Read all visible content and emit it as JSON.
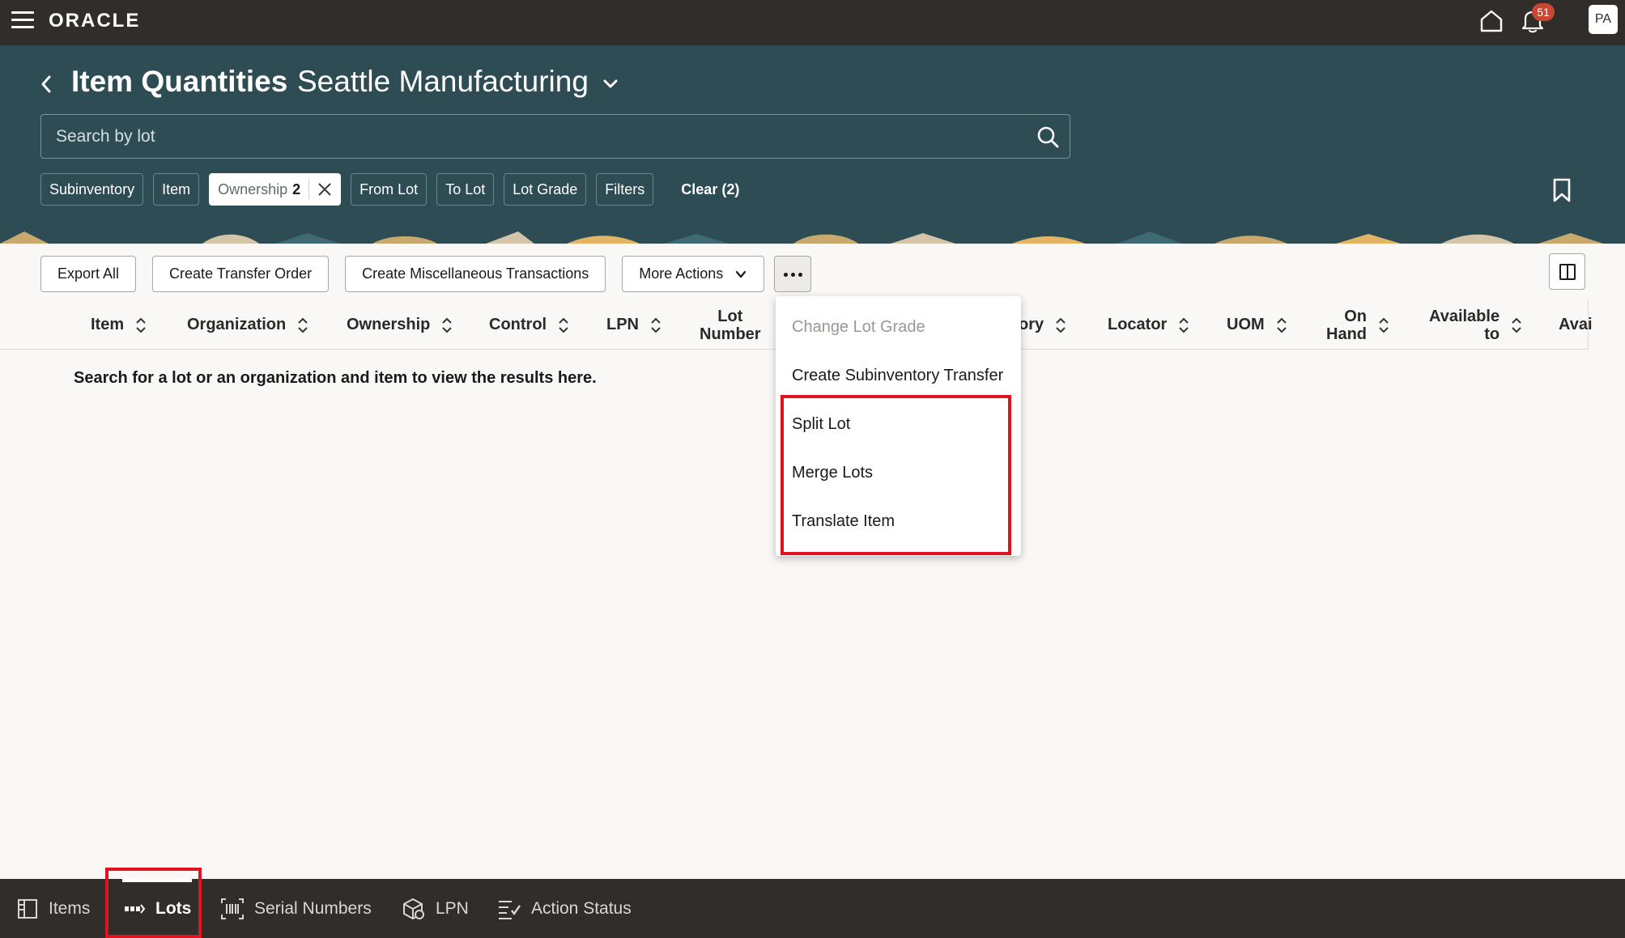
{
  "topbar": {
    "logo": "ORACLE",
    "notification_count": "51",
    "avatar_initials": "PA"
  },
  "header": {
    "title": "Item Quantities",
    "organization": "Seattle Manufacturing",
    "search": {
      "placeholder": "Search by lot",
      "value": ""
    },
    "chips": [
      {
        "label": "Subinventory"
      },
      {
        "label": "Item"
      },
      {
        "label": "Ownership",
        "count": "2"
      },
      {
        "label": "From Lot"
      },
      {
        "label": "To Lot"
      },
      {
        "label": "Lot Grade"
      },
      {
        "label": "Filters"
      }
    ],
    "clear_label": "Clear (2)"
  },
  "toolbar": {
    "export_all": "Export All",
    "create_transfer_order": "Create Transfer Order",
    "create_misc_transactions": "Create Miscellaneous Transactions",
    "more_actions": "More Actions"
  },
  "table": {
    "columns": [
      {
        "line1": "Item"
      },
      {
        "line1": "Organization"
      },
      {
        "line1": "Ownership"
      },
      {
        "line1": "Control"
      },
      {
        "line1": "LPN"
      },
      {
        "line1": "Lot",
        "line2": "Number"
      },
      {
        "line1": "ory"
      },
      {
        "line1": "Locator"
      },
      {
        "line1": "UOM"
      },
      {
        "line1": "On",
        "line2": "Hand"
      },
      {
        "line1": "Available",
        "line2": "to"
      },
      {
        "line1": "Avai"
      }
    ],
    "empty_message": "Search for a lot or an organization and item to view the results here."
  },
  "overflow_menu": {
    "items": [
      {
        "label": "Change Lot Grade",
        "disabled": true
      },
      {
        "label": "Create Subinventory Transfer",
        "disabled": false
      },
      {
        "label": "Split Lot",
        "disabled": false
      },
      {
        "label": "Merge Lots",
        "disabled": false
      },
      {
        "label": "Translate Item",
        "disabled": false
      }
    ]
  },
  "bottom_tabs": {
    "items": [
      {
        "label": "Items",
        "icon": "items-icon"
      },
      {
        "label": "Lots",
        "icon": "lots-icon",
        "active": true
      },
      {
        "label": "Serial Numbers",
        "icon": "serial-numbers-icon"
      },
      {
        "label": "LPN",
        "icon": "lpn-icon"
      },
      {
        "label": "Action Status",
        "icon": "action-status-icon"
      }
    ]
  },
  "colors": {
    "topbar": "#312d2a",
    "header": "#2e4c54",
    "content_bg": "#f9f8f6",
    "highlight": "#e0141e",
    "badge": "#c74634"
  }
}
